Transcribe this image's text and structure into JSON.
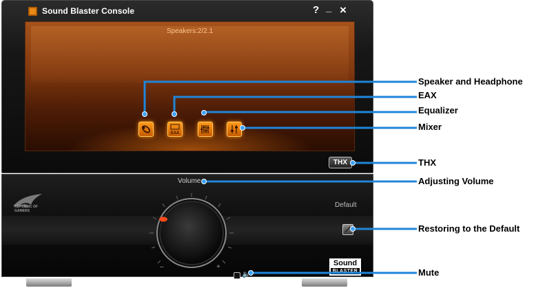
{
  "window": {
    "title": "Sound Blaster Console",
    "help_label": "?",
    "minimize_label": "_",
    "close_label": "×"
  },
  "screen": {
    "speaker_status": "Speakers:2/2.1",
    "eax_button_label": "EAX"
  },
  "thx": {
    "badge_label": "THX"
  },
  "volume": {
    "label": "Volume",
    "min_label": "–",
    "max_label": "+"
  },
  "default": {
    "label": "Default"
  },
  "brand": {
    "rog_text_1": "REPUBLIC OF",
    "rog_text_2": "GAMERS",
    "sb_top": "Sound",
    "sb_bottom": "BLASTER"
  },
  "callouts": {
    "speaker_headphone": "Speaker and Headphone",
    "eax": "EAX",
    "equalizer": "Equalizer",
    "mixer": "Mixer",
    "thx": "THX",
    "adjusting_volume": "Adjusting Volume",
    "restoring_default": "Restoring to the Default",
    "mute": "Mute"
  },
  "colors": {
    "accent_orange": "#ff8a00",
    "callout_line": "#1f86d9",
    "panel_dark": "#0b0b0b"
  },
  "icons": [
    "app-icon",
    "help-icon",
    "minimize-icon",
    "close-icon",
    "speaker-headphone-icon",
    "eax-icon",
    "equalizer-icon",
    "mixer-icon",
    "restore-default-icon",
    "mute-speaker-icon",
    "rog-logo",
    "sound-blaster-logo"
  ]
}
